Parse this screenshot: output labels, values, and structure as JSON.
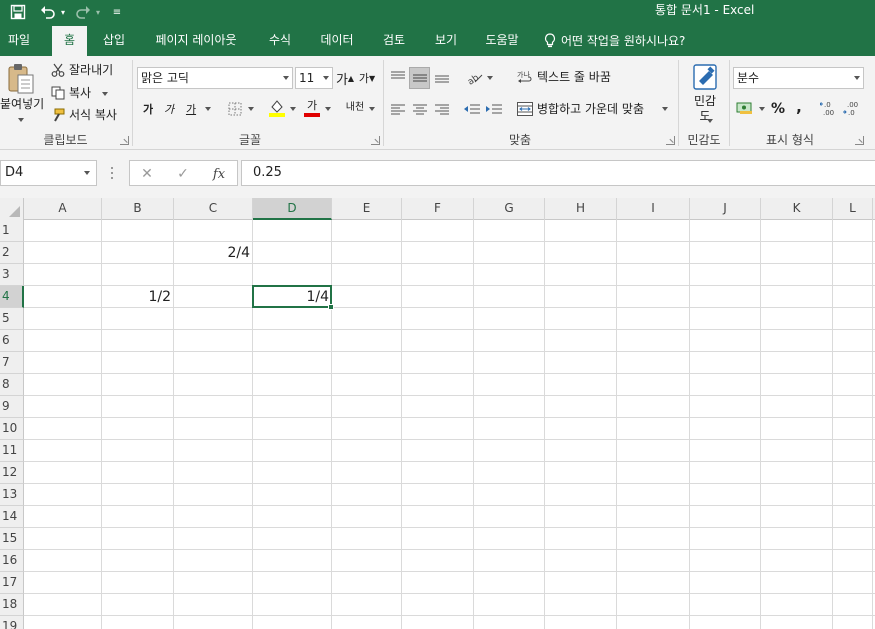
{
  "window": {
    "title": "통합 문서1  -  Excel",
    "accent": "#217346"
  },
  "quick_access": {
    "save_icon": "save-icon",
    "undo_icon": "undo-icon",
    "redo_icon": "redo-icon",
    "customize_icon": "customize-quick-access-icon"
  },
  "tabs": [
    {
      "label": "파일"
    },
    {
      "label": "홈"
    },
    {
      "label": "삽입"
    },
    {
      "label": "페이지 레이아웃"
    },
    {
      "label": "수식"
    },
    {
      "label": "데이터"
    },
    {
      "label": "검토"
    },
    {
      "label": "보기"
    },
    {
      "label": "도움말"
    },
    {
      "label": "어떤 작업을 원하시나요?"
    }
  ],
  "ribbon": {
    "clipboard": {
      "paste_label": "붙여넣기",
      "cut_label": "잘라내기",
      "copy_label": "복사",
      "format_painter_label": "서식 복사",
      "group_label": "클립보드"
    },
    "font": {
      "font_name": "맑은 고딕",
      "font_size": "11",
      "grow_label": "가",
      "shrink_label": "가",
      "bold_label": "가",
      "italic_label": "가",
      "underline_label": "가",
      "font_color_label": "가",
      "phonetic_label": "내천",
      "group_label": "글꼴"
    },
    "alignment": {
      "wrap_text_label": "텍스트 줄 바꿈",
      "merge_center_label": "병합하고 가운데 맞춤",
      "group_label": "맞춤"
    },
    "sensitivity": {
      "button_label": "민감\n도",
      "group_label": "민감도"
    },
    "number": {
      "format": "분수",
      "percent_label": "%",
      "comma_label": ",",
      "group_label": "표시 형식"
    }
  },
  "formula_bar": {
    "name_box": "D4",
    "formula": "0.25",
    "fx_label": "fx"
  },
  "sheet": {
    "columns": [
      "A",
      "B",
      "C",
      "D",
      "E",
      "F",
      "G",
      "H",
      "I",
      "J",
      "K",
      "L"
    ],
    "rows": [
      "1",
      "2",
      "3",
      "4",
      "5",
      "6",
      "7",
      "8",
      "9",
      "10",
      "11",
      "12",
      "13",
      "14",
      "15",
      "16",
      "17",
      "18",
      "19"
    ],
    "selected_column": "D",
    "selected_row": "4",
    "cells": [
      {
        "ref": "C2",
        "value": "2/4"
      },
      {
        "ref": "B4",
        "value": "1/2"
      },
      {
        "ref": "D4",
        "value": "1/4"
      }
    ]
  }
}
